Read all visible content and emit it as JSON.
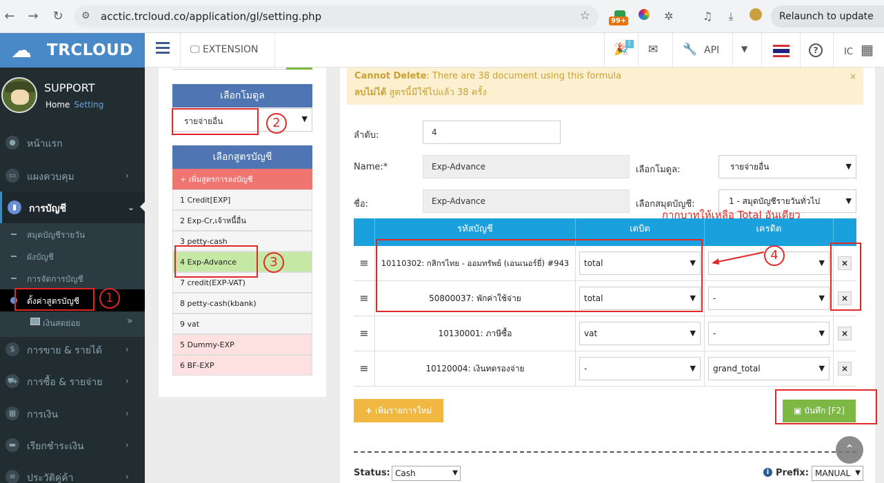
{
  "browser": {
    "url": "acctic.trcloud.co/application/gl/setting.php",
    "badge": "99+",
    "relaunch_label": "Relaunch to update"
  },
  "header": {
    "brand": "TRCLOUD",
    "extension_label": "EXTENSION",
    "api_label": "API",
    "ic_label": "IC",
    "notif_count": "!"
  },
  "sidebar": {
    "user_name": "SUPPORT",
    "crumb_home": "Home",
    "crumb_setting": "Setting",
    "items": [
      {
        "label": "หน้าแรก"
      },
      {
        "label": "แผงควบคุม"
      },
      {
        "label": "การบัญชี"
      },
      {
        "label": "การขาย & รายได้"
      },
      {
        "label": "การซื้อ & รายจ่าย"
      },
      {
        "label": "การเงิน"
      },
      {
        "label": "เรียกชำระเงิน"
      },
      {
        "label": "ประวัติคู่ค้า"
      }
    ],
    "sub_items": [
      {
        "label": "สมุดบัญชีรายวัน"
      },
      {
        "label": "ผังบัญชี"
      },
      {
        "label": "การจัดการบัญชี"
      },
      {
        "label": "ตั้งค่าสูตรบัญชี"
      },
      {
        "label": "เงินสดย่อย"
      }
    ]
  },
  "left_panel": {
    "module_title": "เลือกโมดูล",
    "module_value": "รายจ่ายอื่น",
    "formula_title": "เลือกสูตรบัญชี",
    "add_formula": "เพิ่มสูตรการลงบัญชี",
    "formulas": [
      "1 Credit[EXP]",
      "2 Exp-Cr,เจ้าหนี้อื่น",
      "3 petty-cash",
      "4 Exp-Advance",
      "7 credit(EXP-VAT)",
      "8 petty-cash(kbank)",
      "9 vat",
      "5 Dummy-EXP",
      "6 BF-EXP"
    ]
  },
  "alert": {
    "title_en": "Cannot Delete",
    "msg_en": ": There are 38 document using this formula",
    "title_th": "ลบไม่ได้",
    "msg_th": " สูตรนี้มีใช้ไปแล้ว 38 ครั้ง",
    "close": "×"
  },
  "form": {
    "order_label": "ลำดับ:",
    "order_value": "4",
    "name_label": "Name:*",
    "name_value": "Exp-Advance",
    "thai_name_label": "ชื่อ:",
    "thai_name_value": "Exp-Advance",
    "module_label": "เลือกโมดูล:",
    "module_value": "รายจ่ายอื่น",
    "journal_label": "เลือกสมุดบัญชี:",
    "journal_value": "1 - สมุดบัญชีรายวันทั่วไป"
  },
  "table": {
    "headers": [
      "รหัสบัญชี",
      "เดบิต",
      "เครดิต"
    ],
    "rows": [
      {
        "account": "10110302: กสิกรไทย - ออมทรัพย์ (เอนเนอร์ยี่) #943",
        "debit": "total",
        "credit": ""
      },
      {
        "account": "50800037: พักค่าใช้จ่าย",
        "debit": "total",
        "credit": "-"
      },
      {
        "account": "10130001: ภาษีซื้อ",
        "debit": "vat",
        "credit": "-"
      },
      {
        "account": "10120004: เงินทดรองจ่าย",
        "debit": "-",
        "credit": "grand_total"
      }
    ],
    "delete_glyph": "×",
    "handle_glyph": "≡"
  },
  "actions": {
    "add_row": "เพิ่มรายการใหม่",
    "save": "บันทึก [F2]"
  },
  "footer": {
    "status_label": "Status:",
    "status_value": "Cash",
    "prefix_label": "Prefix:",
    "prefix_value": "MANUAL"
  },
  "annotations": {
    "n1": "1",
    "n2": "2",
    "n3": "3",
    "n4": "4",
    "note": "กากบาทให้เหลือ Total อันเดียว"
  },
  "colors": {
    "sidebar_bg": "#222d32",
    "brand_blue": "#4a89c8",
    "table_head": "#1aa0dc",
    "save_green": "#7cb843",
    "add_orange": "#f0b840",
    "annotation_red": "#e32626"
  }
}
